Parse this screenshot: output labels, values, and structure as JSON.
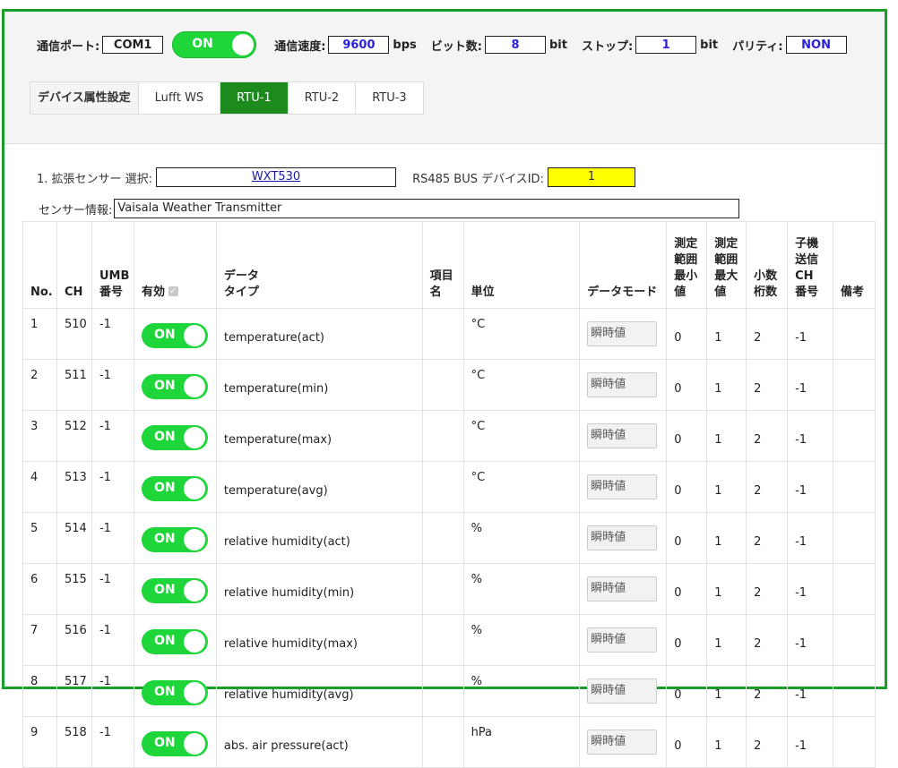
{
  "comm": {
    "port_label": "通信ポート:",
    "port_value": "COM1",
    "toggle_label": "ON",
    "speed_label": "通信速度:",
    "speed_value": "9600",
    "speed_unit": "bps",
    "bits_label": "ビット数:",
    "bits_value": "8",
    "bits_unit": "bit",
    "stop_label": "ストップ:",
    "stop_value": "1",
    "stop_unit": "bit",
    "parity_label": "パリティ:",
    "parity_value": "NON"
  },
  "tabs": {
    "title": "デバイス属性設定",
    "items": [
      {
        "label": "Lufft WS",
        "active": false
      },
      {
        "label": "RTU-1",
        "active": true
      },
      {
        "label": "RTU-2",
        "active": false
      },
      {
        "label": "RTU-3",
        "active": false
      }
    ]
  },
  "sensor": {
    "select_label": "1. 拡張センサー 選択:",
    "select_value": "WXT530",
    "busid_label": "RS485 BUS デバイスID:",
    "busid_value": "1",
    "info_label": "センサー情報:",
    "info_value": "Vaisala Weather Transmitter"
  },
  "table": {
    "headers": {
      "no": "No.",
      "ch": "CH",
      "umb": [
        "UMB",
        "番号"
      ],
      "enabled": "有効",
      "datatype": [
        "データ",
        "タイプ"
      ],
      "item": [
        "項目",
        "名"
      ],
      "unit": "単位",
      "mode": "データモード",
      "min": [
        "測定",
        "範囲",
        "最小",
        "値"
      ],
      "max": [
        "測定",
        "範囲",
        "最大",
        "値"
      ],
      "decimals": [
        "小数",
        "桁数"
      ],
      "slave": [
        "子機",
        "送信",
        "CH",
        "番号"
      ],
      "note": "備考"
    },
    "toggle_label": "ON",
    "mode_value": "瞬時値",
    "rows": [
      {
        "no": "1",
        "ch": "510",
        "umb": "-1",
        "type": "temperature(act)",
        "unit": "°C",
        "min": "0",
        "max": "1",
        "dec": "2",
        "slave": "-1"
      },
      {
        "no": "2",
        "ch": "511",
        "umb": "-1",
        "type": "temperature(min)",
        "unit": "°C",
        "min": "0",
        "max": "1",
        "dec": "2",
        "slave": "-1"
      },
      {
        "no": "3",
        "ch": "512",
        "umb": "-1",
        "type": "temperature(max)",
        "unit": "°C",
        "min": "0",
        "max": "1",
        "dec": "2",
        "slave": "-1"
      },
      {
        "no": "4",
        "ch": "513",
        "umb": "-1",
        "type": "temperature(avg)",
        "unit": "°C",
        "min": "0",
        "max": "1",
        "dec": "2",
        "slave": "-1"
      },
      {
        "no": "5",
        "ch": "514",
        "umb": "-1",
        "type": "relative humidity(act)",
        "unit": "%",
        "min": "0",
        "max": "1",
        "dec": "2",
        "slave": "-1"
      },
      {
        "no": "6",
        "ch": "515",
        "umb": "-1",
        "type": "relative humidity(min)",
        "unit": "%",
        "min": "0",
        "max": "1",
        "dec": "2",
        "slave": "-1"
      },
      {
        "no": "7",
        "ch": "516",
        "umb": "-1",
        "type": "relative humidity(max)",
        "unit": "%",
        "min": "0",
        "max": "1",
        "dec": "2",
        "slave": "-1"
      },
      {
        "no": "8",
        "ch": "517",
        "umb": "-1",
        "type": "relative humidity(avg)",
        "unit": "%",
        "min": "0",
        "max": "1",
        "dec": "2",
        "slave": "-1"
      },
      {
        "no": "9",
        "ch": "518",
        "umb": "-1",
        "type": "abs. air pressure(act)",
        "unit": "hPa",
        "min": "0",
        "max": "1",
        "dec": "2",
        "slave": "-1"
      }
    ]
  }
}
